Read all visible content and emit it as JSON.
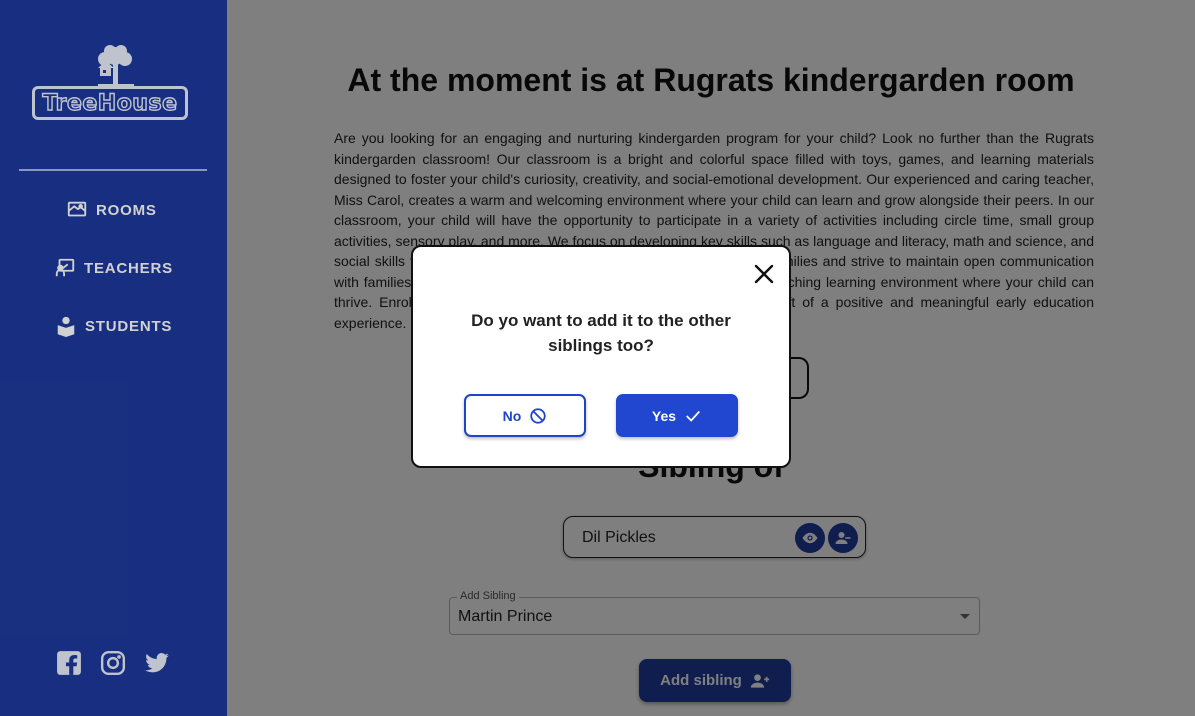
{
  "sidebar": {
    "logo_text": "TreeHouse",
    "nav": [
      {
        "label": "ROOMS",
        "icon": "room-icon"
      },
      {
        "label": "TEACHERS",
        "icon": "teacher-icon"
      },
      {
        "label": "STUDENTS",
        "icon": "student-icon"
      }
    ],
    "socials": [
      "facebook-icon",
      "instagram-icon",
      "twitter-icon"
    ]
  },
  "main": {
    "title": "At the moment is at Rugrats kindergarden room",
    "description": "Are you looking for an engaging and nurturing kindergarden program for your child? Look no further than the Rugrats kindergarden classroom! Our classroom is a bright and colorful space filled with toys, games, and learning materials designed to foster your child's curiosity, creativity, and social-emotional development. Our experienced and caring teacher, Miss Carol, creates a warm and welcoming environment where your child can learn and grow alongside their peers. In our classroom, your child will have the opportunity to participate in a variety of activities including circle time, small group activities, sensory play, and more. We focus on developing key skills such as language and literacy, math and science, and social skills through play-based learning. We value partnerships with families and strive to maintain open communication with families throughout the year. We provide a safe, nurturing, and enriching learning environment where your child can thrive. Enroll your child in our classroom today and give them the gift of a positive and meaningful early education experience.",
    "sibling_title": "Sibling of",
    "sibling_name": "Dil Pickles",
    "add_sibling_label": "Add Sibling",
    "add_sibling_value": "Martin Prince",
    "add_sibling_button": "Add sibling"
  },
  "modal": {
    "message": "Do yo want to add it to the other siblings too?",
    "no_label": "No",
    "yes_label": "Yes"
  },
  "colors": {
    "sidebar": "#1e3a9e",
    "primary": "#2146cf"
  }
}
